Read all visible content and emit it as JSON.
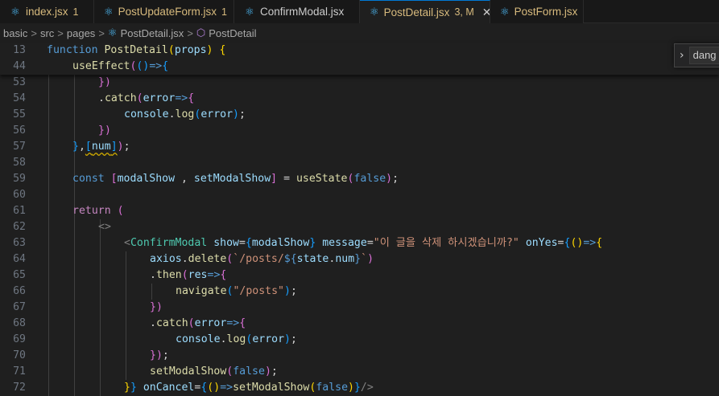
{
  "tabs": [
    {
      "name": "index.jsx",
      "count": "1",
      "warn": true,
      "active": false
    },
    {
      "name": "PostUpdateForm.jsx",
      "count": "1",
      "warn": true,
      "active": false
    },
    {
      "name": "ConfirmModal.jsx",
      "count": "",
      "warn": false,
      "active": false
    },
    {
      "name": "PostDetail.jsx",
      "count": "3, M",
      "warn": true,
      "active": true,
      "close": "✕"
    },
    {
      "name": "PostForm.jsx",
      "count": "1",
      "warn": true,
      "active": false
    }
  ],
  "breadcrumb": {
    "parts": [
      "basic",
      "src",
      "pages",
      "PostDetail.jsx",
      "PostDetail"
    ],
    "separator": ">"
  },
  "find": {
    "value": "dang"
  },
  "icons": {
    "react": "react-icon",
    "symbol": "symbol-class-icon",
    "chevron": "chevron-right-icon"
  },
  "colors": {
    "background": "#1f1f1f",
    "accent": "#0078d4",
    "warning": "#d7ba7d",
    "lineNumber": "#6e7681"
  },
  "code_lines": [
    {
      "ln": "13",
      "indent": 0,
      "sticky": true,
      "tokens": [
        [
          "kw",
          "function "
        ],
        [
          "fn",
          "PostDetail"
        ],
        [
          "b1",
          "("
        ],
        [
          "var",
          "props"
        ],
        [
          "b1",
          ")"
        ],
        [
          "plain",
          " "
        ],
        [
          "b1",
          "{"
        ]
      ]
    },
    {
      "ln": "44",
      "indent": 1,
      "sticky": true,
      "tokens": [
        [
          "fn",
          "useEffect"
        ],
        [
          "b2",
          "("
        ],
        [
          "b3",
          "()"
        ],
        [
          "kw",
          "=>"
        ],
        [
          "b3",
          "{"
        ]
      ]
    },
    {
      "ln": "53",
      "indent": 2,
      "tokens": [
        [
          "b2",
          "})"
        ]
      ]
    },
    {
      "ln": "54",
      "indent": 2,
      "tokens": [
        [
          "plain",
          "."
        ],
        [
          "fn",
          "catch"
        ],
        [
          "b2",
          "("
        ],
        [
          "var",
          "error"
        ],
        [
          "kw",
          "=>"
        ],
        [
          "b2",
          "{"
        ]
      ]
    },
    {
      "ln": "55",
      "indent": 3,
      "tokens": [
        [
          "var",
          "console"
        ],
        [
          "plain",
          "."
        ],
        [
          "fn",
          "log"
        ],
        [
          "b3",
          "("
        ],
        [
          "var",
          "error"
        ],
        [
          "b3",
          ")"
        ],
        [
          "plain",
          ";"
        ]
      ]
    },
    {
      "ln": "56",
      "indent": 2,
      "tokens": [
        [
          "b2",
          "})"
        ]
      ]
    },
    {
      "ln": "57",
      "indent": 1,
      "tokens": [
        [
          "b3",
          "}"
        ],
        [
          "plain",
          ","
        ],
        [
          "b3sq",
          "["
        ],
        [
          "varsq",
          "num"
        ],
        [
          "b3sq",
          "]"
        ],
        [
          "b2",
          ")"
        ],
        [
          "plain",
          ";"
        ]
      ]
    },
    {
      "ln": "58",
      "indent": 0,
      "tokens": []
    },
    {
      "ln": "59",
      "indent": 1,
      "tokens": [
        [
          "kw",
          "const "
        ],
        [
          "b2",
          "["
        ],
        [
          "var",
          "modalShow"
        ],
        [
          "plain",
          " , "
        ],
        [
          "var",
          "setModalShow"
        ],
        [
          "b2",
          "]"
        ],
        [
          "plain",
          " = "
        ],
        [
          "fn",
          "useState"
        ],
        [
          "b2",
          "("
        ],
        [
          "kw",
          "false"
        ],
        [
          "b2",
          ")"
        ],
        [
          "plain",
          ";"
        ]
      ]
    },
    {
      "ln": "60",
      "indent": 0,
      "tokens": []
    },
    {
      "ln": "61",
      "indent": 1,
      "tokens": [
        [
          "ctl",
          "return "
        ],
        [
          "b2",
          "("
        ]
      ]
    },
    {
      "ln": "62",
      "indent": 2,
      "tokens": [
        [
          "tagb",
          "<>"
        ]
      ]
    },
    {
      "ln": "63",
      "indent": 3,
      "tokens": [
        [
          "tagb",
          "<"
        ],
        [
          "tag",
          "ConfirmModal"
        ],
        [
          "plain",
          " "
        ],
        [
          "attr",
          "show"
        ],
        [
          "plain",
          "="
        ],
        [
          "b3",
          "{"
        ],
        [
          "var",
          "modalShow"
        ],
        [
          "b3",
          "}"
        ],
        [
          "plain",
          " "
        ],
        [
          "attr",
          "message"
        ],
        [
          "plain",
          "="
        ],
        [
          "str",
          "\"이 글을 삭제 하시겠습니까?\""
        ],
        [
          "plain",
          " "
        ],
        [
          "attr",
          "onYes"
        ],
        [
          "plain",
          "="
        ],
        [
          "b3",
          "{"
        ],
        [
          "b1",
          "()"
        ],
        [
          "kw",
          "=>"
        ],
        [
          "b1",
          "{"
        ]
      ]
    },
    {
      "ln": "64",
      "indent": 4,
      "tokens": [
        [
          "var",
          "axios"
        ],
        [
          "plain",
          "."
        ],
        [
          "fn",
          "delete"
        ],
        [
          "b2",
          "("
        ],
        [
          "str",
          "`/posts/"
        ],
        [
          "kw",
          "${"
        ],
        [
          "var",
          "state"
        ],
        [
          "plain",
          "."
        ],
        [
          "var",
          "num"
        ],
        [
          "kw",
          "}"
        ],
        [
          "str",
          "`"
        ],
        [
          "b2",
          ")"
        ]
      ]
    },
    {
      "ln": "65",
      "indent": 4,
      "tokens": [
        [
          "plain",
          "."
        ],
        [
          "fn",
          "then"
        ],
        [
          "b2",
          "("
        ],
        [
          "var",
          "res"
        ],
        [
          "kw",
          "=>"
        ],
        [
          "b2",
          "{"
        ]
      ]
    },
    {
      "ln": "66",
      "indent": 5,
      "tokens": [
        [
          "fn",
          "navigate"
        ],
        [
          "b3",
          "("
        ],
        [
          "str",
          "\"/posts\""
        ],
        [
          "b3",
          ")"
        ],
        [
          "plain",
          ";"
        ]
      ]
    },
    {
      "ln": "67",
      "indent": 4,
      "tokens": [
        [
          "b2",
          "})"
        ]
      ]
    },
    {
      "ln": "68",
      "indent": 4,
      "tokens": [
        [
          "plain",
          "."
        ],
        [
          "fn",
          "catch"
        ],
        [
          "b2",
          "("
        ],
        [
          "var",
          "error"
        ],
        [
          "kw",
          "=>"
        ],
        [
          "b2",
          "{"
        ]
      ]
    },
    {
      "ln": "69",
      "indent": 5,
      "tokens": [
        [
          "var",
          "console"
        ],
        [
          "plain",
          "."
        ],
        [
          "fn",
          "log"
        ],
        [
          "b3",
          "("
        ],
        [
          "var",
          "error"
        ],
        [
          "b3",
          ")"
        ],
        [
          "plain",
          ";"
        ]
      ]
    },
    {
      "ln": "70",
      "indent": 4,
      "tokens": [
        [
          "b2",
          "})"
        ],
        [
          "plain",
          ";"
        ]
      ]
    },
    {
      "ln": "71",
      "indent": 4,
      "tokens": [
        [
          "fn",
          "setModalShow"
        ],
        [
          "b2",
          "("
        ],
        [
          "kw",
          "false"
        ],
        [
          "b2",
          ")"
        ],
        [
          "plain",
          ";"
        ]
      ]
    },
    {
      "ln": "72",
      "indent": 3,
      "tokens": [
        [
          "b1",
          "}"
        ],
        [
          "b3",
          "}"
        ],
        [
          "plain",
          " "
        ],
        [
          "attr",
          "onCancel"
        ],
        [
          "plain",
          "="
        ],
        [
          "b3",
          "{"
        ],
        [
          "b1",
          "()"
        ],
        [
          "kw",
          "=>"
        ],
        [
          "fn",
          "setModalShow"
        ],
        [
          "b1",
          "("
        ],
        [
          "kw",
          "false"
        ],
        [
          "b1",
          ")"
        ],
        [
          "b3",
          "}"
        ],
        [
          "tagb",
          "/>"
        ]
      ]
    }
  ]
}
